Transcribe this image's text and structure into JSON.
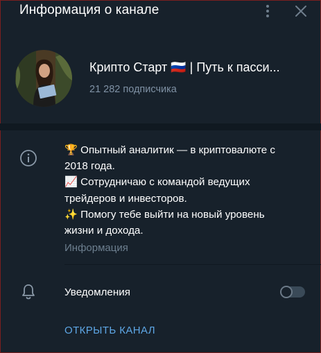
{
  "header": {
    "title": "Информация о канале",
    "menu_icon": "kebab-icon",
    "close_icon": "close-icon"
  },
  "channel": {
    "name": "Крипто Старт 🇷🇺 | Путь к пасси...",
    "subscribers": "21 282 подписчика"
  },
  "description": {
    "lines": [
      "🏆 Опытный аналитик — в криптовалюте с",
      "2018 года.",
      "📈 Сотрудничаю с командой ведущих",
      "трейдеров и инвесторов.",
      "✨ Помогу тебе выйти на новый уровень",
      "жизни и дохода."
    ],
    "label": "Информация"
  },
  "notifications": {
    "label": "Уведомления",
    "enabled": false
  },
  "actions": {
    "open_channel": "ОТКРЫТЬ КАНАЛ"
  },
  "colors": {
    "background": "#17212b",
    "secondary_text": "#7f91a4",
    "accent": "#5ea7e6",
    "separator": "#101921"
  }
}
